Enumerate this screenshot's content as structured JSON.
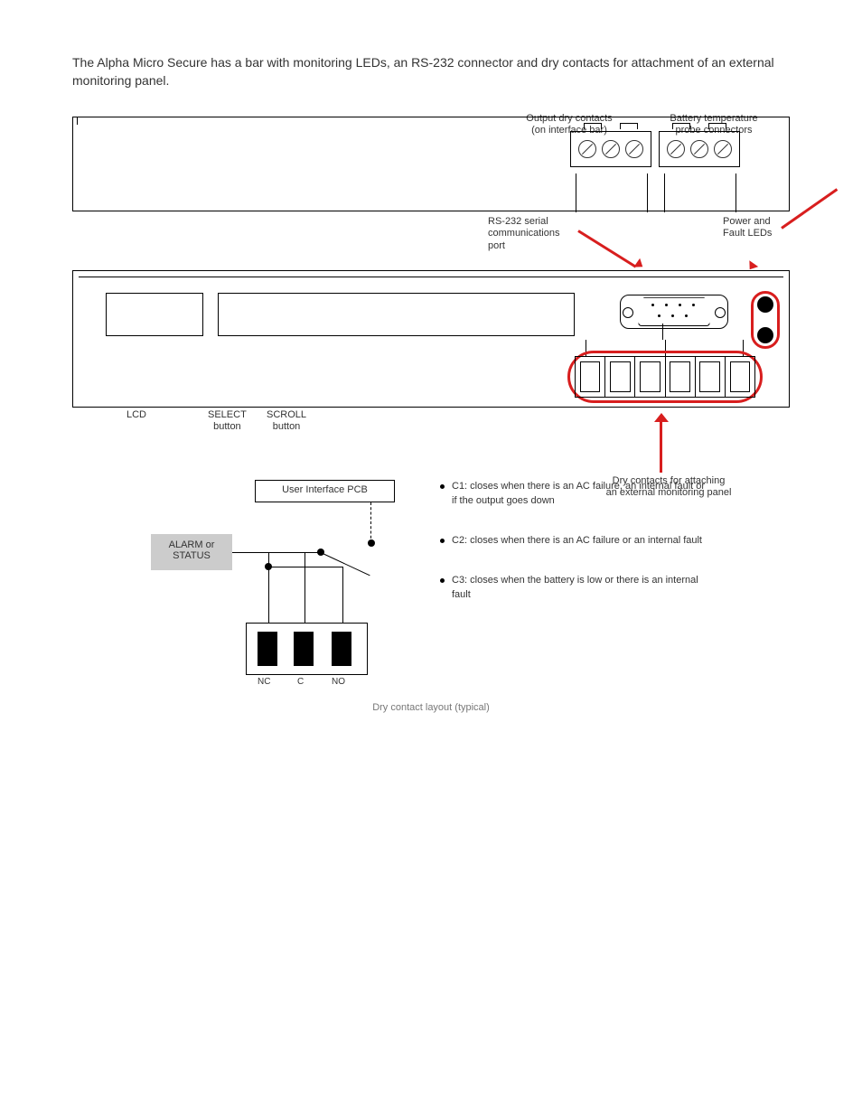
{
  "intro": "The Alpha Micro Secure has a bar with monitoring LEDs, an RS-232 connector and dry contacts for attachment of an external monitoring panel.",
  "topPanel": {
    "leftConnLabel": "Output dry contacts\n(on interface bar)",
    "rightConnLabel": "Battery temperature\nprobe connectors"
  },
  "frontPanel": {
    "leftTopLabel": "LCD",
    "buttonsLeft": "SELECT\nbutton",
    "buttonsRight": "SCROLL\nbutton",
    "serialCallout": "RS-232 serial\ncommunications\nport",
    "ledsCallout": "Power and\nFault LEDs",
    "contactsCallout": "Dry contacts for attaching\nan external monitoring panel"
  },
  "dryContacts": {
    "userInterface": "User Interface PCB",
    "alarmLabel": "ALARM or\nSTATUS",
    "nc": "NC",
    "c": "C",
    "no": "NO",
    "figureCaption": "Dry contact layout (typical)",
    "bullets": [
      "C1: closes when there is an AC failure, an internal fault or if the output goes down",
      "C2: closes when there is an AC failure or an internal fault",
      "C3: closes when the battery is low or there is an internal fault"
    ]
  }
}
